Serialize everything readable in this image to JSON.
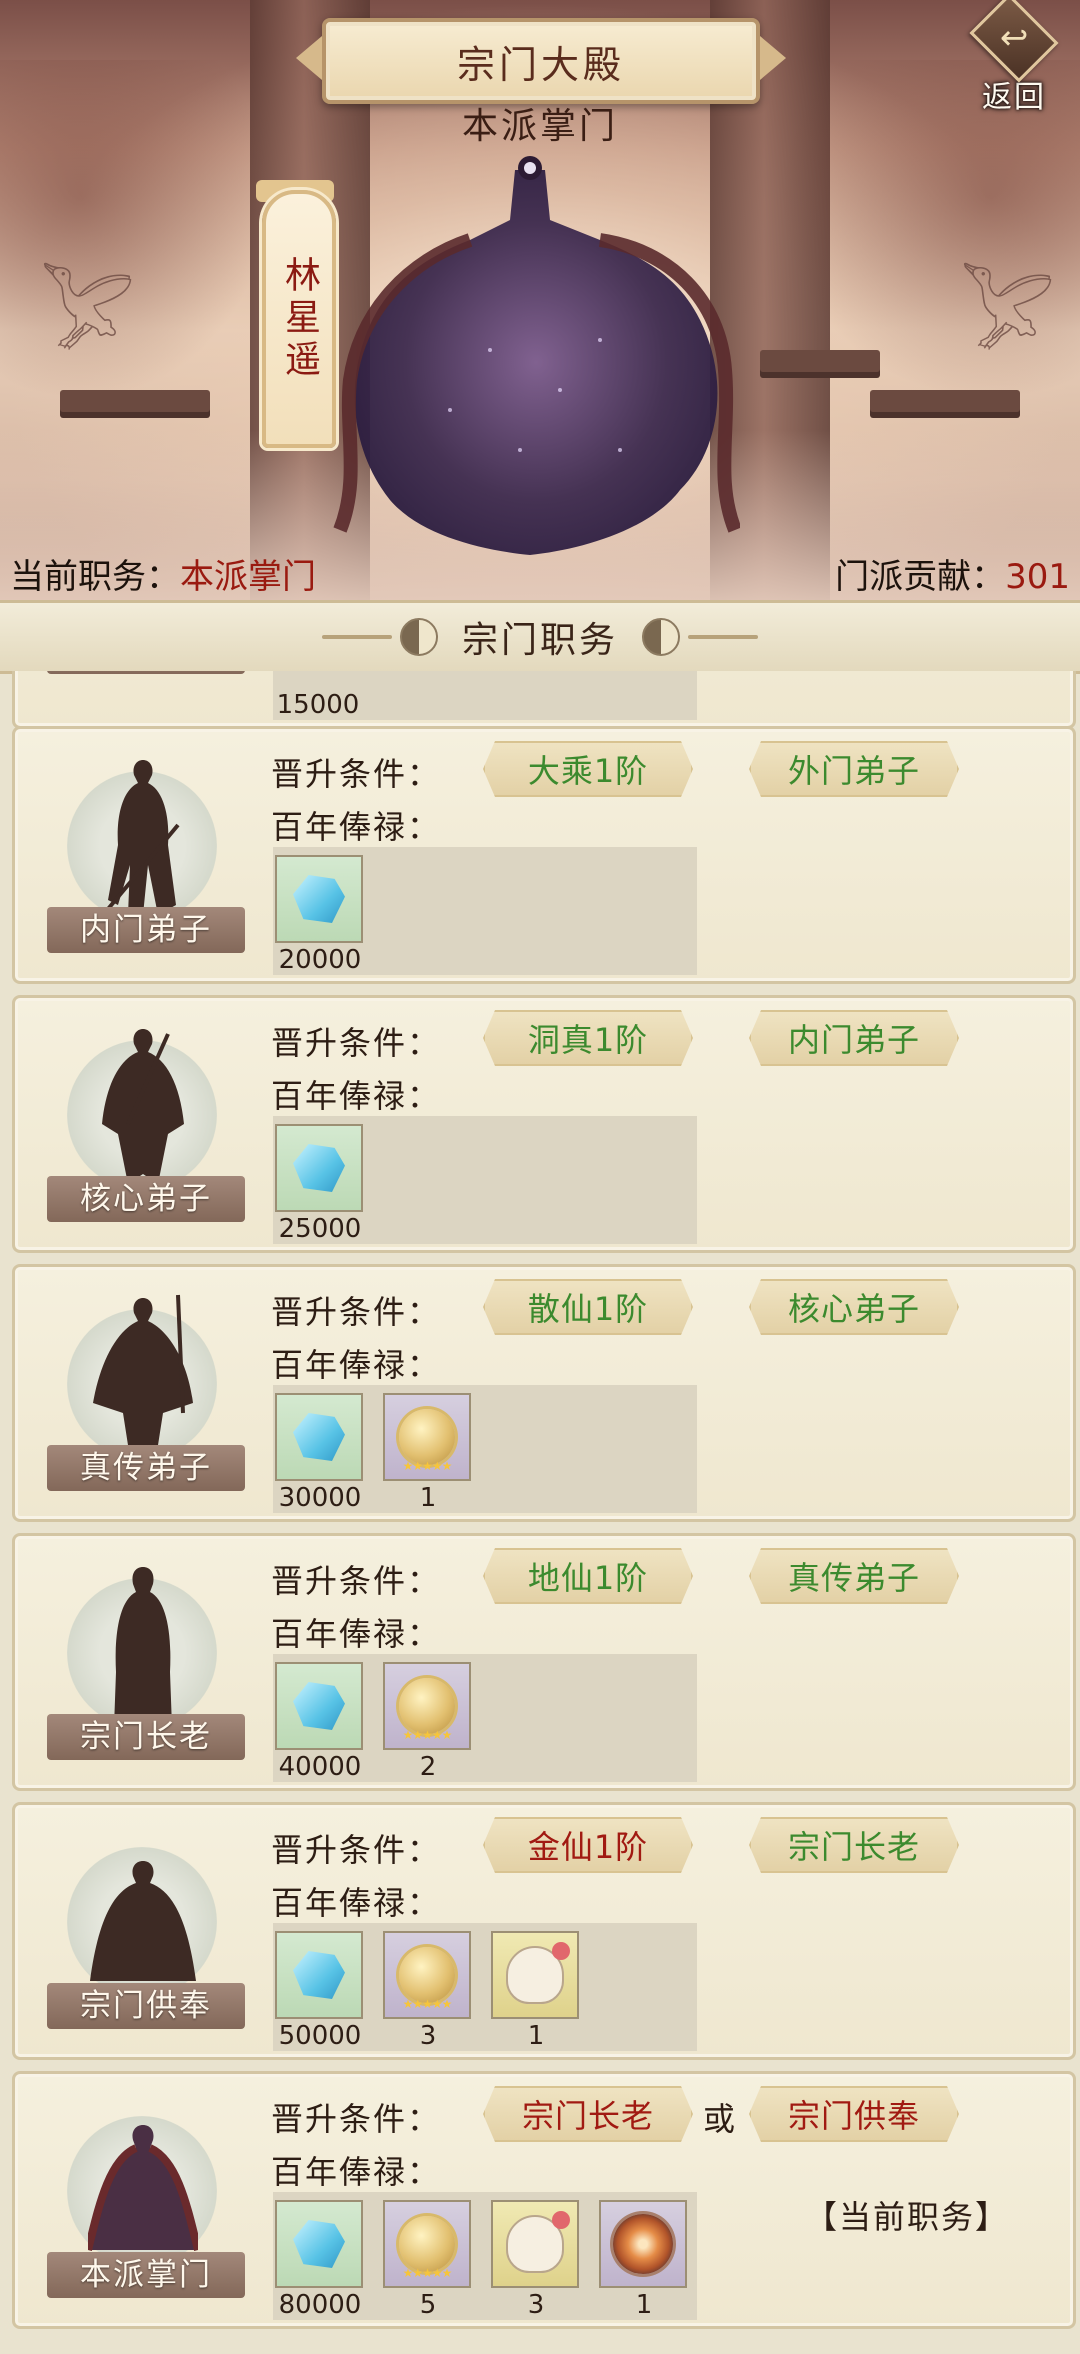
{
  "header": {
    "title": "宗门大殿",
    "subtitle": "本派掌门",
    "back_label": "返回",
    "leader_name": "林星遥"
  },
  "status": {
    "position_label": "当前职务：",
    "position_value": "本派掌门",
    "contribution_label": "门派贡献：",
    "contribution_value": "301"
  },
  "section_title": "宗门职务",
  "labels": {
    "condition": "晋升条件：",
    "salary": "百年俸禄：",
    "or": "或",
    "current": "【当前职务】"
  },
  "partial_row": {
    "reward_count": "15000"
  },
  "ranks": [
    {
      "name": "内门弟子",
      "requirements": [
        {
          "text": "大乘1阶",
          "met": true
        },
        {
          "text": "外门弟子",
          "met": true
        }
      ],
      "rewards": [
        {
          "icon": "spirit-stone-icon",
          "count": "20000"
        }
      ]
    },
    {
      "name": "核心弟子",
      "requirements": [
        {
          "text": "洞真1阶",
          "met": true
        },
        {
          "text": "内门弟子",
          "met": true
        }
      ],
      "rewards": [
        {
          "icon": "spirit-stone-icon",
          "count": "25000"
        }
      ]
    },
    {
      "name": "真传弟子",
      "requirements": [
        {
          "text": "散仙1阶",
          "met": true
        },
        {
          "text": "核心弟子",
          "met": true
        }
      ],
      "rewards": [
        {
          "icon": "spirit-stone-icon",
          "count": "30000"
        },
        {
          "icon": "golden-pill-icon",
          "count": "1"
        }
      ]
    },
    {
      "name": "宗门长老",
      "requirements": [
        {
          "text": "地仙1阶",
          "met": true
        },
        {
          "text": "真传弟子",
          "met": true
        }
      ],
      "rewards": [
        {
          "icon": "spirit-stone-icon",
          "count": "40000"
        },
        {
          "icon": "golden-pill-icon",
          "count": "2"
        }
      ]
    },
    {
      "name": "宗门供奉",
      "requirements": [
        {
          "text": "金仙1阶",
          "met": false
        },
        {
          "text": "宗门长老",
          "met": true
        }
      ],
      "rewards": [
        {
          "icon": "spirit-stone-icon",
          "count": "50000"
        },
        {
          "icon": "golden-pill-icon",
          "count": "3"
        },
        {
          "icon": "beast-skull-icon",
          "count": "1"
        }
      ]
    },
    {
      "name": "本派掌门",
      "requirements": [
        {
          "text": "宗门长老",
          "met": false
        },
        {
          "text": "宗门供奉",
          "met": false
        }
      ],
      "rewards": [
        {
          "icon": "spirit-stone-icon",
          "count": "80000"
        },
        {
          "icon": "golden-pill-icon",
          "count": "5"
        },
        {
          "icon": "beast-skull-icon",
          "count": "3"
        },
        {
          "icon": "fire-orb-icon",
          "count": "1"
        }
      ],
      "is_current": true
    }
  ],
  "colors": {
    "requirement_met": "#3c8a2e",
    "requirement_unmet": "#a11a12",
    "status_value": "#9a1a10"
  }
}
